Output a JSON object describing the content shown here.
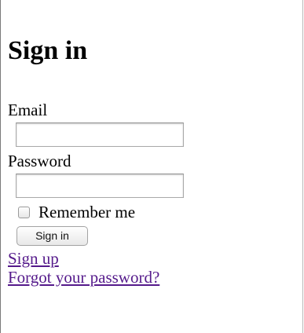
{
  "heading": "Sign in",
  "form": {
    "email_label": "Email",
    "email_value": "",
    "password_label": "Password",
    "password_value": "",
    "remember_label": "Remember me",
    "remember_checked": false,
    "submit_label": "Sign in"
  },
  "links": {
    "sign_up": "Sign up",
    "forgot_password": "Forgot your password?"
  },
  "colors": {
    "visited_link": "#551a8b",
    "background": "#ffffff"
  }
}
